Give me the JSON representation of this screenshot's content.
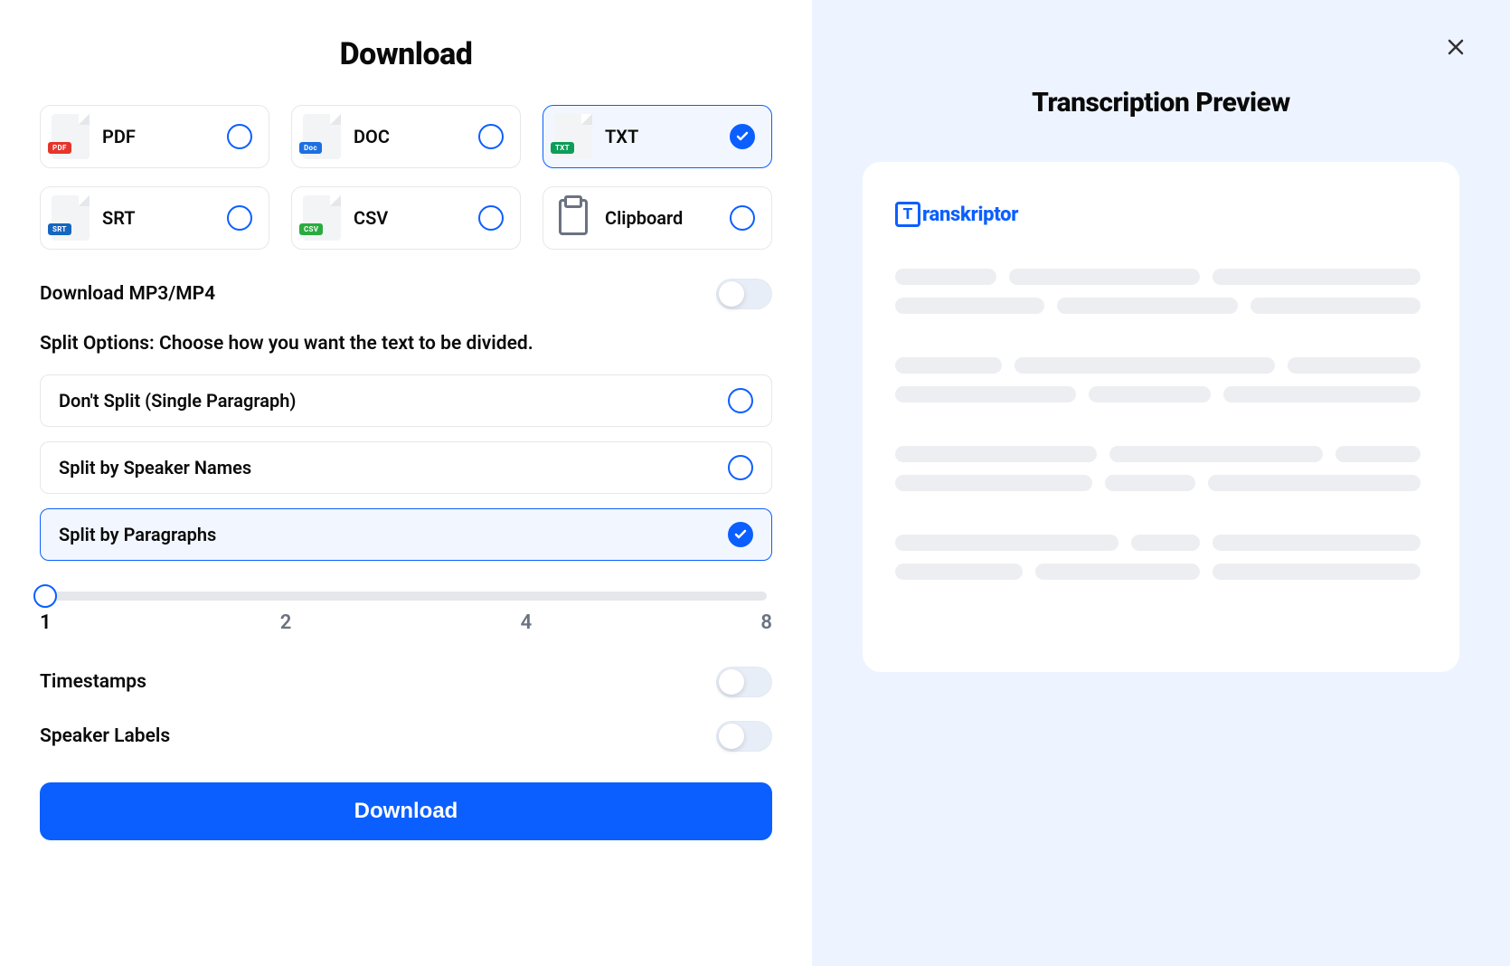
{
  "title": "Download",
  "formats": [
    {
      "id": "pdf",
      "label": "PDF",
      "badge": "PDF",
      "badgeClass": "badge-pdf",
      "selected": false
    },
    {
      "id": "doc",
      "label": "DOC",
      "badge": "Doc",
      "badgeClass": "badge-doc",
      "selected": false
    },
    {
      "id": "txt",
      "label": "TXT",
      "badge": "TXT",
      "badgeClass": "badge-txt",
      "selected": true
    },
    {
      "id": "srt",
      "label": "SRT",
      "badge": "SRT",
      "badgeClass": "badge-srt",
      "selected": false
    },
    {
      "id": "csv",
      "label": "CSV",
      "badge": "CSV",
      "badgeClass": "badge-csv",
      "selected": false
    },
    {
      "id": "clipboard",
      "label": "Clipboard",
      "badge": null,
      "badgeClass": null,
      "selected": false
    }
  ],
  "download_media": {
    "label": "Download MP3/MP4",
    "enabled": false
  },
  "split": {
    "heading": "Split Options: Choose how you want the text to be divided.",
    "options": [
      {
        "id": "none",
        "label": "Don't Split (Single Paragraph)",
        "selected": false
      },
      {
        "id": "speaker",
        "label": "Split by Speaker Names",
        "selected": false
      },
      {
        "id": "paragraph",
        "label": "Split by Paragraphs",
        "selected": true
      }
    ]
  },
  "slider": {
    "value": 1,
    "ticks": [
      "1",
      "2",
      "4",
      "8"
    ]
  },
  "timestamps": {
    "label": "Timestamps",
    "enabled": false
  },
  "speaker_labels": {
    "label": "Speaker Labels",
    "enabled": false
  },
  "download_button": "Download",
  "preview": {
    "title": "Transcription Preview",
    "brand": "ranskriptor",
    "brand_letter": "T"
  }
}
